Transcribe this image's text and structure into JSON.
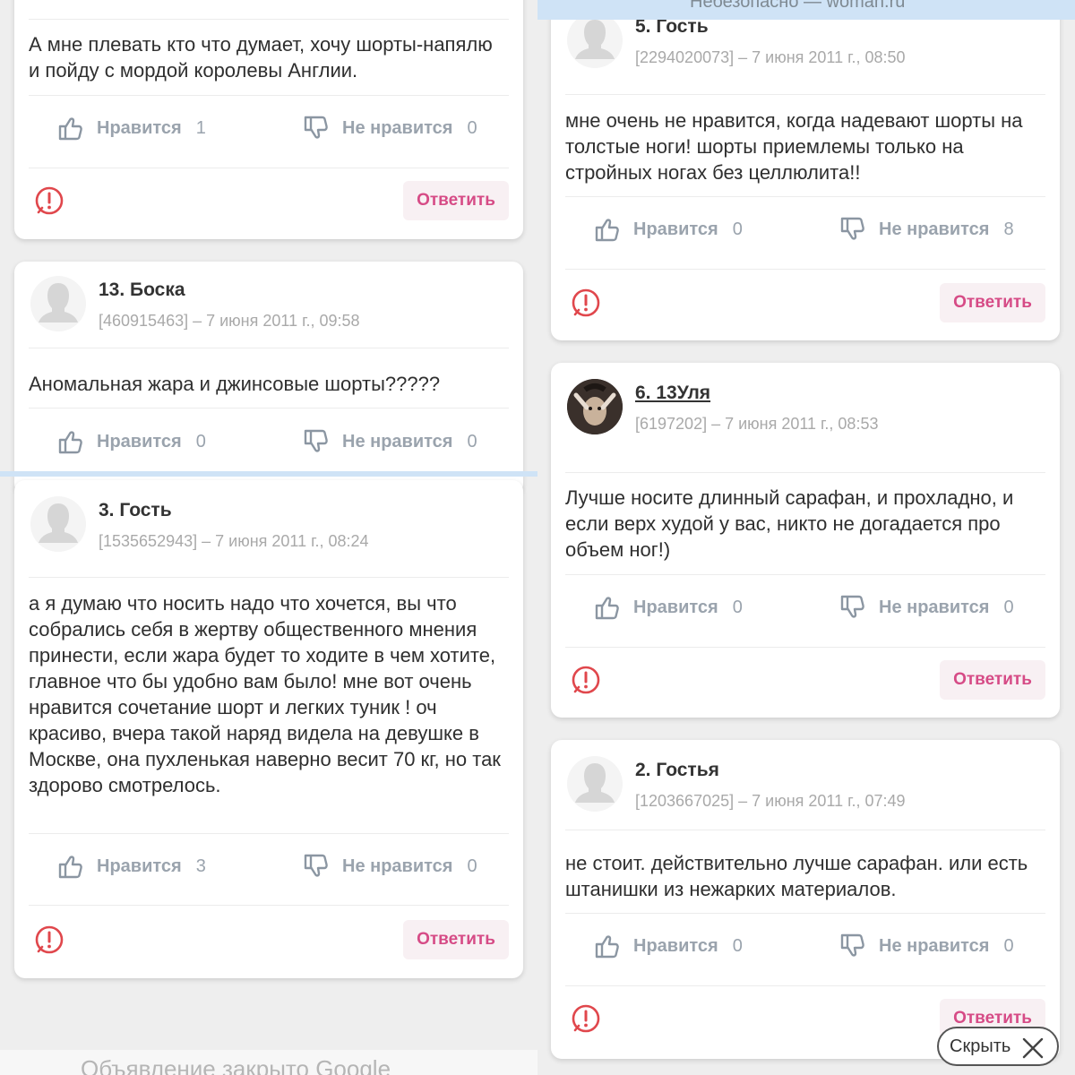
{
  "browser": {
    "url_text": "Небезопасно — woman.ru"
  },
  "labels": {
    "like": "Нравится",
    "dislike": "Не нравится",
    "reply": "Ответить"
  },
  "left": {
    "c1": {
      "text": "А мне плевать кто что думает, хочу шорты-напялю и пойду с мордой королевы Англии.",
      "likes": "1",
      "dislikes": "0"
    },
    "c13": {
      "author": "13. Боска",
      "stamp": "[460915463] – 7 июня 2011 г., 09:58",
      "text": "Аномальная жара и джинсовые шорты?????",
      "likes": "0",
      "dislikes": "0"
    },
    "c3": {
      "author": "3. Гость",
      "stamp": "[1535652943] – 7 июня 2011 г., 08:24",
      "text": "а я думаю что носить надо что хочется, вы что собрались себя в жертву общественного мнения принести, если жара будет то ходите в чем хотите, главное что бы удобно вам было! мне вот очень нравится сочетание шорт и легких туник ! оч красиво, вчера такой наряд видела на девушке в Москве, она пухленькая наверно весит 70 кг, но так здорово смотрелось.",
      "likes": "3",
      "dislikes": "0"
    }
  },
  "right": {
    "c5": {
      "author": "5. Гость",
      "stamp": "[2294020073] – 7 июня 2011 г., 08:50",
      "text": "мне очень не нравится, когда надевают шорты на толстые ноги! шорты приемлемы только на стройных ногах без целлюлита!!",
      "likes": "0",
      "dislikes": "8"
    },
    "c6": {
      "author": "6. 13Уля",
      "stamp": "[6197202] – 7 июня 2011 г., 08:53",
      "text": "Лучше носите длинный сарафан, и прохладно, и если верх худой у вас, никто не догадается про объем ног!)",
      "likes": "0",
      "dislikes": "0"
    },
    "c2": {
      "author": "2. Гостья",
      "stamp": "[1203667025] – 7 июня 2011 г., 07:49",
      "text": "не стоит. действительно лучше сарафан. или есть штанишки из нежарких материалов.",
      "likes": "0",
      "dislikes": "0"
    }
  },
  "ad": {
    "closed_text": "Объявление закрыто Google"
  },
  "hide_button": {
    "label": "Скрыть"
  },
  "colors": {
    "accent": "#d64b86",
    "muted": "#9aa3ad",
    "report": "#e0474c",
    "divider": "#cfe3f6"
  }
}
